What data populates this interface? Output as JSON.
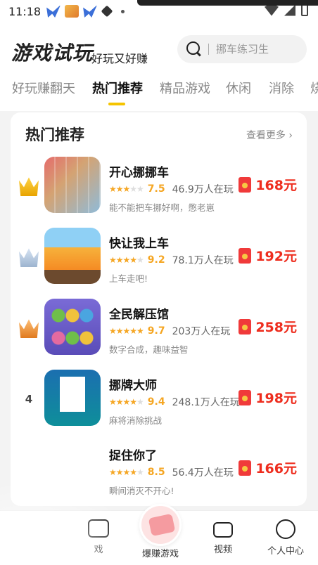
{
  "status_bar": {
    "time": "11:18"
  },
  "header": {
    "title": "游戏试玩",
    "subtitle": "好玩又好赚",
    "search": {
      "placeholder": "挪车练习生"
    }
  },
  "tabs": [
    {
      "label": "好玩赚翻天",
      "active": false
    },
    {
      "label": "热门推荐",
      "active": true
    },
    {
      "label": "精品游戏",
      "active": false
    },
    {
      "label": "休闲",
      "active": false
    },
    {
      "label": "消除",
      "active": false
    },
    {
      "label": "烧",
      "active": false
    }
  ],
  "card": {
    "title": "热门推荐",
    "see_more": "查看更多 ›",
    "games": [
      {
        "rank": "1",
        "name": "开心挪挪车",
        "rating": "7.5",
        "stars": 3.5,
        "players": "46.9万人在玩",
        "desc": "能不能把车挪好啊，憋老崽",
        "reward": "168元",
        "thumb_icon": "parking-game-icon"
      },
      {
        "rank": "2",
        "name": "快让我上车",
        "rating": "9.2",
        "stars": 4.5,
        "players": "78.1万人在玩",
        "desc": "上车走吧!",
        "reward": "192元",
        "thumb_icon": "bus-game-icon"
      },
      {
        "rank": "3",
        "name": "全民解压馆",
        "rating": "9.7",
        "stars": 5,
        "players": "203万人在玩",
        "desc": "数字合成，趣味益智",
        "reward": "258元",
        "thumb_icon": "stack-game-icon"
      },
      {
        "rank": "4",
        "name": "挪牌大师",
        "rating": "9.4",
        "stars": 4.5,
        "players": "248.1万人在玩",
        "desc": "麻将消除挑战",
        "reward": "198元",
        "thumb_icon": "mahjong-game-icon"
      },
      {
        "rank": "",
        "name": "捉住你了",
        "rating": "8.5",
        "stars": 4,
        "players": "56.4万人在玩",
        "desc": "瞬间消灭不开心!",
        "reward": "166元",
        "thumb_icon": "catch-game-icon"
      }
    ]
  },
  "bottom_nav": [
    {
      "label": "戏",
      "icon": "game-icon"
    },
    {
      "label": "爆赚游戏",
      "icon": "money-icon"
    },
    {
      "label": "视频",
      "icon": "video-icon"
    },
    {
      "label": "个人中心",
      "icon": "face-icon"
    }
  ],
  "colors": {
    "accent": "#f5c400",
    "reward": "#ee2d1e",
    "star": "#f5a623"
  }
}
